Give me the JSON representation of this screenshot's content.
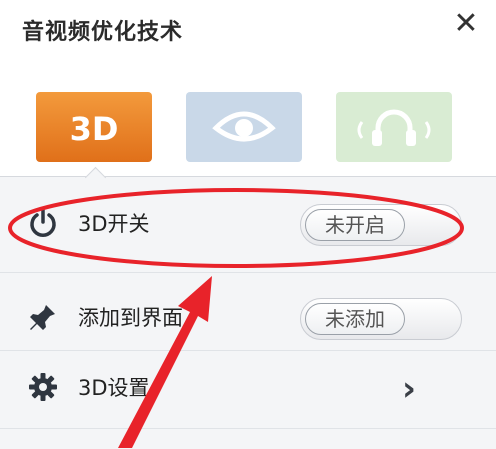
{
  "header": {
    "title": "音视频优化技术",
    "close_glyph": "✕"
  },
  "tabs": [
    {
      "label": "3D",
      "icon": "3d-icon",
      "active": true,
      "color": "#e0701a"
    },
    {
      "label": "",
      "icon": "eye-icon",
      "active": false,
      "color": "#c9d8e8"
    },
    {
      "label": "",
      "icon": "headphones-icon",
      "active": false,
      "color": "#d9ecd3"
    }
  ],
  "rows": [
    {
      "label": "3D开关",
      "icon": "power-icon",
      "control": "toggle",
      "value": "未开启"
    },
    {
      "label": "添加到界面",
      "icon": "pin-icon",
      "control": "toggle",
      "value": "未添加"
    },
    {
      "label": "3D设置",
      "icon": "gear-icon",
      "control": "chevron",
      "value": "›"
    }
  ],
  "annotation": {
    "ellipse_color": "#e8232a",
    "arrow_color": "#e8232a"
  }
}
